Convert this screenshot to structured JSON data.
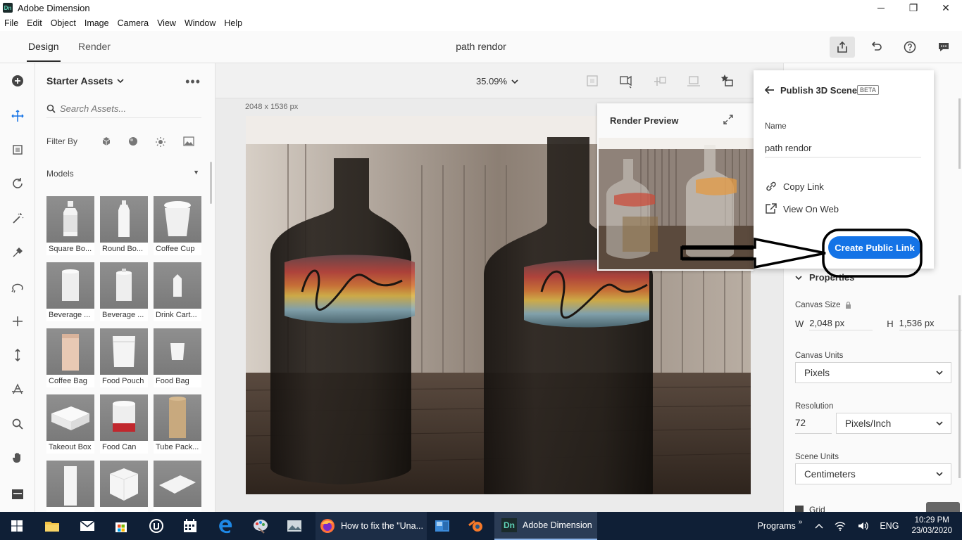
{
  "window": {
    "app_icon": "Dn",
    "title": "Adobe Dimension",
    "controls": [
      "─",
      "❐",
      "✕"
    ]
  },
  "menu": [
    "File",
    "Edit",
    "Object",
    "Image",
    "Camera",
    "View",
    "Window",
    "Help"
  ],
  "header": {
    "tabs": [
      "Design",
      "Render"
    ],
    "active_tab": "Design",
    "document_title": "path rendor",
    "icons": [
      "share-icon",
      "undo-icon",
      "help-icon",
      "feedback-icon"
    ]
  },
  "toolbar": {
    "tools": [
      "add-icon",
      "select-icon",
      "frame-icon",
      "orbit-icon",
      "magic-wand-icon",
      "sampler-icon",
      "lasso-icon",
      "pan-icon",
      "dolly-icon",
      "camera-horizon-icon",
      "zoom-icon",
      "hand-icon",
      "panel-toggle-icon"
    ]
  },
  "assets": {
    "title": "Starter Assets",
    "more": "•••",
    "search_placeholder": "Search Assets...",
    "filter_label": "Filter By",
    "section": "Models",
    "items": [
      {
        "label": "Square Bo..."
      },
      {
        "label": "Round Bo..."
      },
      {
        "label": "Coffee Cup"
      },
      {
        "label": "Beverage ..."
      },
      {
        "label": "Beverage ..."
      },
      {
        "label": "Drink Cart..."
      },
      {
        "label": "Coffee Bag"
      },
      {
        "label": "Food Pouch"
      },
      {
        "label": "Food Bag"
      },
      {
        "label": "Takeout Box"
      },
      {
        "label": "Food Can"
      },
      {
        "label": "Tube Pack..."
      },
      {
        "label": ""
      },
      {
        "label": ""
      },
      {
        "label": ""
      }
    ]
  },
  "canvas": {
    "zoom": "35.09%",
    "dimensions": "2048 x 1536 px"
  },
  "render_preview": {
    "title": "Render Preview"
  },
  "publish": {
    "title": "Publish 3D Scene",
    "badge": "BETA",
    "name_label": "Name",
    "name_value": "path rendor",
    "copy_link": "Copy Link",
    "view_on_web": "View On Web",
    "cta": "Create Public Link"
  },
  "properties": {
    "section": "Properties",
    "canvas_size_label": "Canvas Size",
    "w_label": "W",
    "w_value": "2,048 px",
    "h_label": "H",
    "h_value": "1,536 px",
    "canvas_units_label": "Canvas Units",
    "canvas_units": "Pixels",
    "resolution_label": "Resolution",
    "resolution_value": "72",
    "resolution_units": "Pixels/Inch",
    "scene_units_label": "Scene Units",
    "scene_units": "Centimeters",
    "grid_label": "Grid"
  },
  "taskbar": {
    "apps": [
      "start-icon",
      "file-explorer-icon",
      "mail-icon",
      "store-icon",
      "unreal-icon",
      "calendar-icon",
      "edge-icon",
      "paint-icon",
      "photos-icon",
      "firefox-icon",
      "blender-icon"
    ],
    "firefox_label": "How to fix the \"Una...",
    "active_label": "Adobe Dimension",
    "programs": "Programs",
    "language": "ENG",
    "time": "10:29 PM",
    "date": "23/03/2020"
  }
}
